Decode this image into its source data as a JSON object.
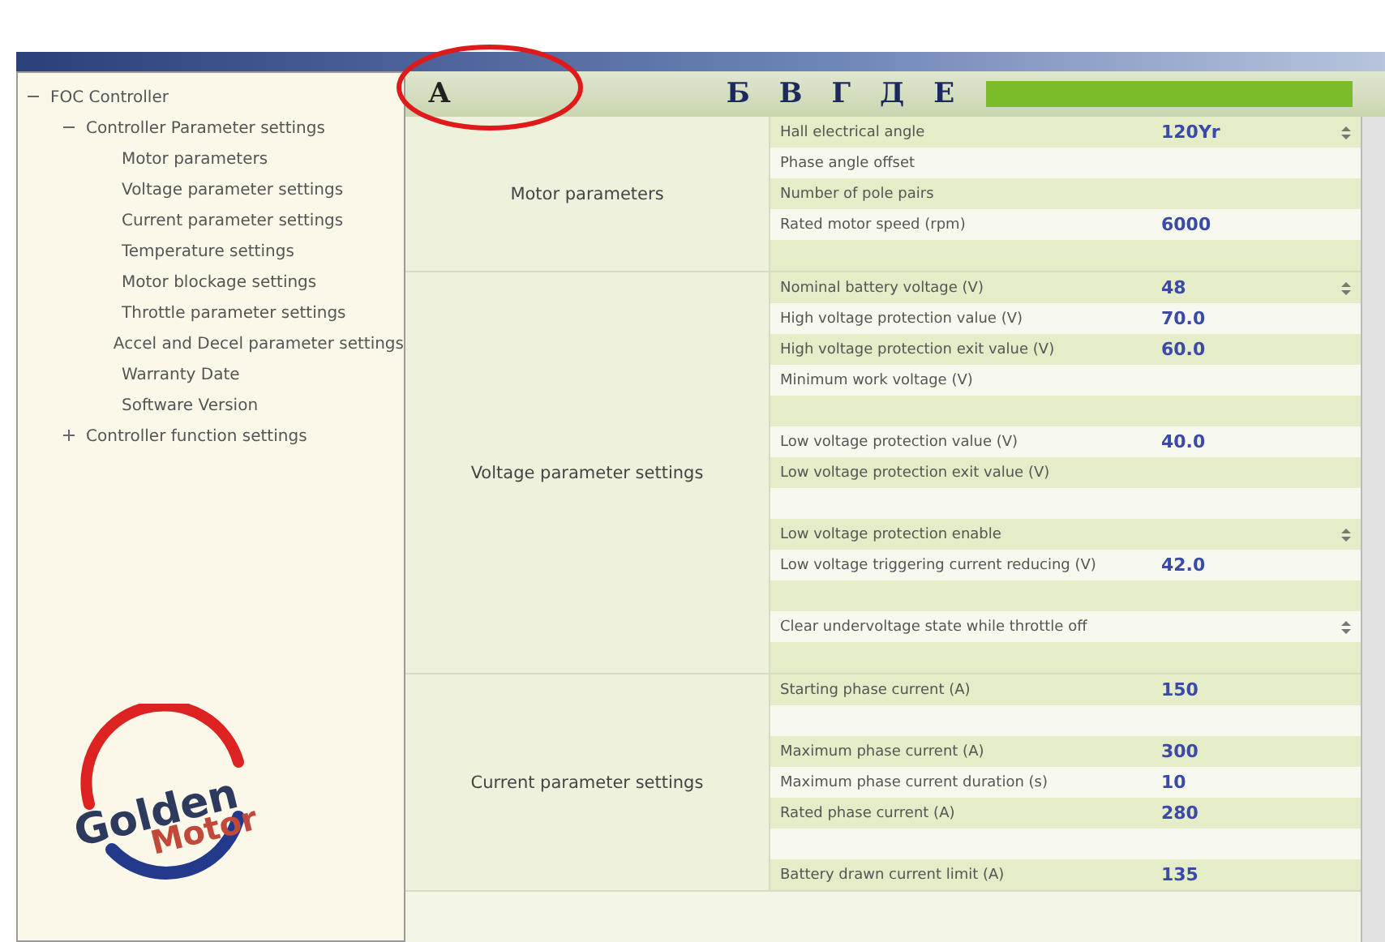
{
  "annotations": [
    {
      "letter": "А",
      "circled": true
    },
    {
      "letter": "Б",
      "circled": false
    },
    {
      "letter": "В",
      "circled": false
    },
    {
      "letter": "Г",
      "circled": false
    },
    {
      "letter": "Д",
      "circled": false
    },
    {
      "letter": "Е",
      "circled": false
    }
  ],
  "logo": {
    "line_1": "Golden",
    "line_2": "Motor"
  },
  "tree": [
    {
      "label": "FOC Controller",
      "expanded": true,
      "children": [
        {
          "label": "Controller Parameter settings",
          "expanded": true,
          "children": [
            {
              "label": "Motor parameters"
            },
            {
              "label": "Voltage parameter settings"
            },
            {
              "label": "Current parameter settings"
            },
            {
              "label": "Temperature settings"
            },
            {
              "label": "Motor blockage settings"
            },
            {
              "label": "Throttle parameter settings"
            },
            {
              "label": "Accel and Decel parameter settings"
            },
            {
              "label": "Warranty Date"
            },
            {
              "label": "Software Version"
            }
          ]
        },
        {
          "label": "Controller function settings",
          "expanded": false
        }
      ]
    }
  ],
  "groups": [
    {
      "label": "Motor parameters",
      "rows": [
        {
          "kind": "param",
          "name": "Hall electrical angle",
          "value": "120Yr",
          "spinner": true
        },
        {
          "kind": "param",
          "name": "Phase angle offset"
        },
        {
          "kind": "param",
          "name": "Number of pole pairs"
        },
        {
          "kind": "param",
          "name": "Rated motor speed (rpm)",
          "value": "6000"
        },
        {
          "kind": "spacer"
        }
      ]
    },
    {
      "label": "Voltage parameter settings",
      "rows": [
        {
          "kind": "param",
          "name": "Nominal battery voltage (V)",
          "value": "48",
          "spinner": true
        },
        {
          "kind": "param",
          "name": "High voltage protection value (V)",
          "value": "70.0"
        },
        {
          "kind": "param",
          "name": "High voltage protection exit value (V)",
          "value": "60.0"
        },
        {
          "kind": "param",
          "name": "Minimum work voltage (V)"
        },
        {
          "kind": "spacer"
        },
        {
          "kind": "param",
          "name": "Low voltage protection value (V)",
          "value": "40.0"
        },
        {
          "kind": "param",
          "name": "Low voltage protection exit value (V)"
        },
        {
          "kind": "spacer"
        },
        {
          "kind": "param",
          "name": "Low voltage protection enable",
          "spinner": true
        },
        {
          "kind": "param",
          "name": "Low voltage triggering current reducing (V)",
          "value": "42.0"
        },
        {
          "kind": "spacer"
        },
        {
          "kind": "param",
          "name": "Clear undervoltage state while throttle off",
          "spinner": true
        },
        {
          "kind": "spacer"
        }
      ]
    },
    {
      "label": "Current parameter settings",
      "rows": [
        {
          "kind": "param",
          "name": "Starting phase current (A)",
          "value": "150"
        },
        {
          "kind": "spacer"
        },
        {
          "kind": "param",
          "name": "Maximum phase current (A)",
          "value": "300"
        },
        {
          "kind": "param",
          "name": "Maximum phase current duration (s)",
          "value": "10"
        },
        {
          "kind": "param",
          "name": "Rated phase current (A)",
          "value": "280"
        },
        {
          "kind": "spacer"
        },
        {
          "kind": "param",
          "name": "Battery drawn current limit (A)",
          "value": "135"
        }
      ]
    }
  ]
}
